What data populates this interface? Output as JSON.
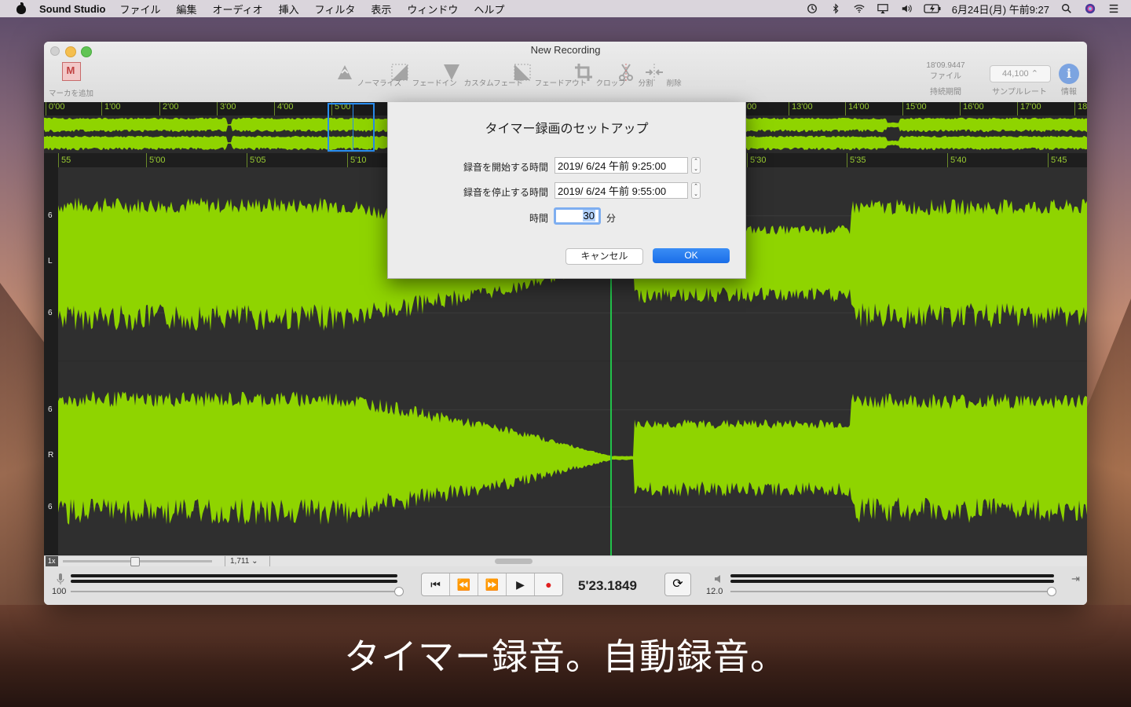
{
  "menubar": {
    "app_name": "Sound Studio",
    "items": [
      "ファイル",
      "編集",
      "オーディオ",
      "挿入",
      "フィルタ",
      "表示",
      "ウィンドウ",
      "ヘルプ"
    ],
    "clock": "6月24日(月) 午前9:27"
  },
  "window": {
    "title": "New Recording",
    "toolbar": {
      "add_marker": "マーカを追加",
      "normalize": "ノーマライズ",
      "fade_in": "フェードイン",
      "custom_fade": "カスタムフェード",
      "fade_out": "フェードアウト",
      "crop": "クロップ",
      "split": "分割",
      "delete": "削除",
      "duration_value": "18'09.9447",
      "duration_sub": "ファイル",
      "duration_label": "持続期間",
      "sample_rate_value": "44,100",
      "sample_rate_label": "サンプルレート",
      "info_label": "情報"
    },
    "overview_ruler": [
      "0'00",
      "1'00",
      "2'00",
      "3'00",
      "4'00",
      "5'00",
      "00",
      "13'00",
      "14'00",
      "15'00",
      "16'00",
      "17'00",
      "18"
    ],
    "detail_ruler": [
      "55",
      "5'00",
      "5'05",
      "5'10",
      "5'30",
      "5'35",
      "5'40",
      "5'45"
    ],
    "channel_labels": [
      "6",
      "L",
      "6",
      "6",
      "R",
      "6"
    ],
    "zoom_label": "1x",
    "zoom_value": "1,711",
    "input_level": "100",
    "timecode": "5'23.1849",
    "output_level": "12.0"
  },
  "dialog": {
    "title": "タイマー録画のセットアップ",
    "start_label": "録音を開始する時間",
    "start_value": "2019/  6/24 午前  9:25:00",
    "stop_label": "録音を停止する時間",
    "stop_value": "2019/  6/24 午前  9:55:00",
    "duration_label": "時間",
    "duration_value": "30",
    "duration_unit": "分",
    "cancel": "キャンセル",
    "ok": "OK"
  },
  "caption": "タイマー録音。自動録音。",
  "colors": {
    "waveform": "#8fd400",
    "playhead": "#22c24a",
    "accent": "#1a6ee8"
  }
}
